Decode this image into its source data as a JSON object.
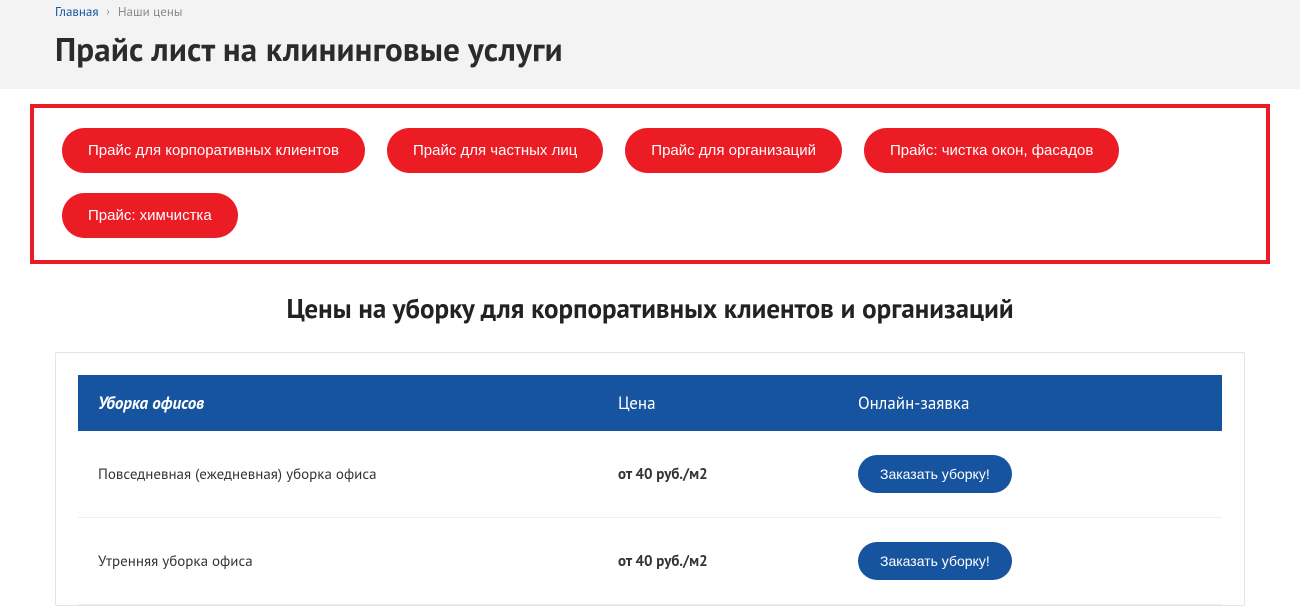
{
  "breadcrumb": {
    "home": "Главная",
    "current": "Наши цены"
  },
  "page_title": "Прайс лист на клининговые услуги",
  "pills": [
    "Прайс для корпоративных клиентов",
    "Прайс для частных лиц",
    "Прайс для организаций",
    "Прайс: чистка окон, фасадов",
    "Прайс: химчистка"
  ],
  "section_title": "Цены на уборку для корпоративных клиентов и организаций",
  "table": {
    "header": {
      "name": "Уборка офисов",
      "price": "Цена",
      "action": "Онлайн-заявка"
    },
    "rows": [
      {
        "name": "Повседневная (ежедневная) уборка офиса",
        "price": "от 40 руб./м2",
        "action": "Заказать уборку!"
      },
      {
        "name": "Утренняя уборка офиса",
        "price": "от 40 руб./м2",
        "action": "Заказать уборку!"
      }
    ]
  }
}
